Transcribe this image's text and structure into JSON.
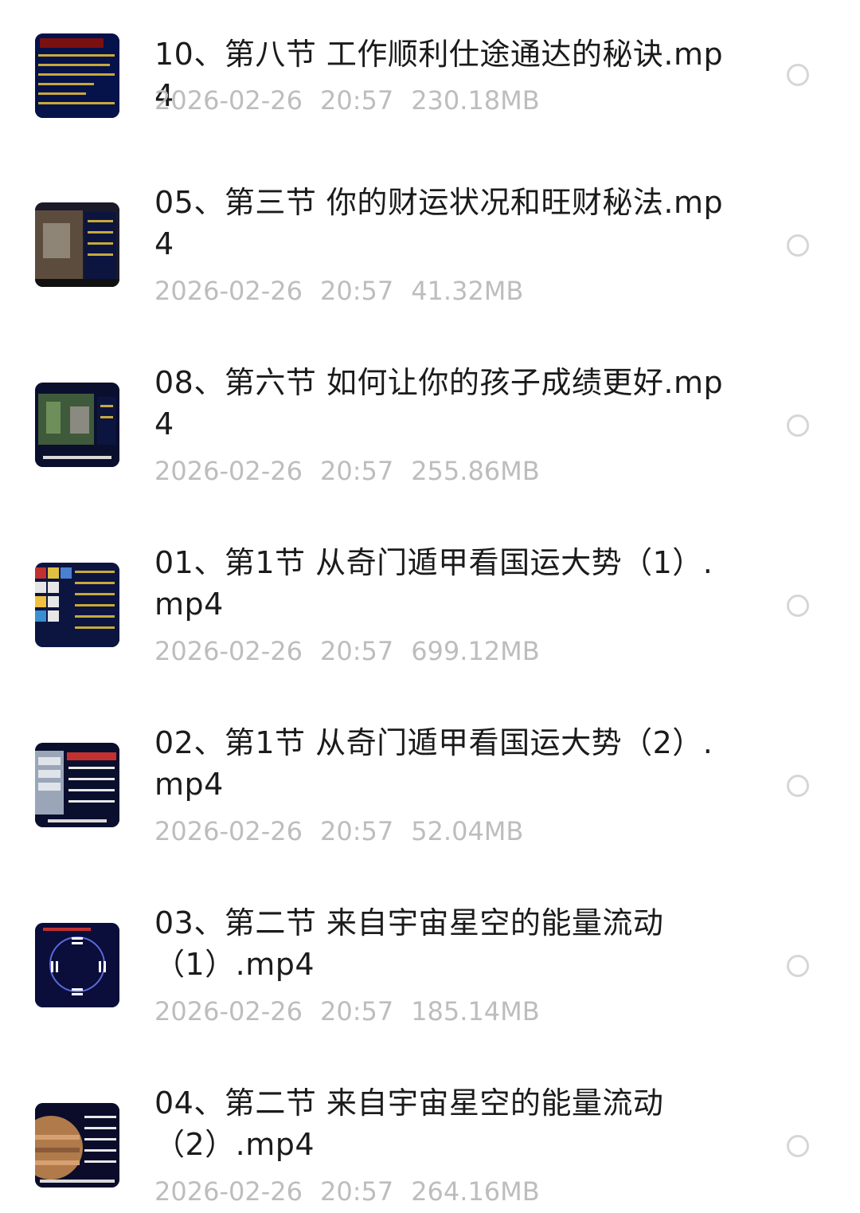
{
  "files": [
    {
      "name": "10、第八节 工作顺利仕途通达的秘诀.mp4",
      "date": "2026-02-26",
      "time": "20:57",
      "size": "230.18MB",
      "thumbnail_icon": "video-thumbnail-icon"
    },
    {
      "name": "05、第三节 你的财运状况和旺财秘法.mp4",
      "date": "2026-02-26",
      "time": "20:57",
      "size": "41.32MB",
      "thumbnail_icon": "video-thumbnail-icon"
    },
    {
      "name": "08、第六节 如何让你的孩子成绩更好.mp4",
      "date": "2026-02-26",
      "time": "20:57",
      "size": "255.86MB",
      "thumbnail_icon": "video-thumbnail-icon"
    },
    {
      "name": "01、第1节 从奇门遁甲看国运大势（1）.mp4",
      "date": "2026-02-26",
      "time": "20:57",
      "size": "699.12MB",
      "thumbnail_icon": "video-thumbnail-icon"
    },
    {
      "name": "02、第1节 从奇门遁甲看国运大势（2）.mp4",
      "date": "2026-02-26",
      "time": "20:57",
      "size": "52.04MB",
      "thumbnail_icon": "video-thumbnail-icon"
    },
    {
      "name": "03、第二节 来自宇宙星空的能量流动（1）.mp4",
      "date": "2026-02-26",
      "time": "20:57",
      "size": "185.14MB",
      "thumbnail_icon": "video-thumbnail-icon"
    },
    {
      "name": "04、第二节 来自宇宙星空的能量流动（2）.mp4",
      "date": "2026-02-26",
      "time": "20:57",
      "size": "264.16MB",
      "thumbnail_icon": "video-thumbnail-icon"
    }
  ],
  "colors": {
    "title": "#1b1b1b",
    "meta": "#bdbdbd",
    "radio_border": "#d6d6d6",
    "background": "#ffffff"
  }
}
